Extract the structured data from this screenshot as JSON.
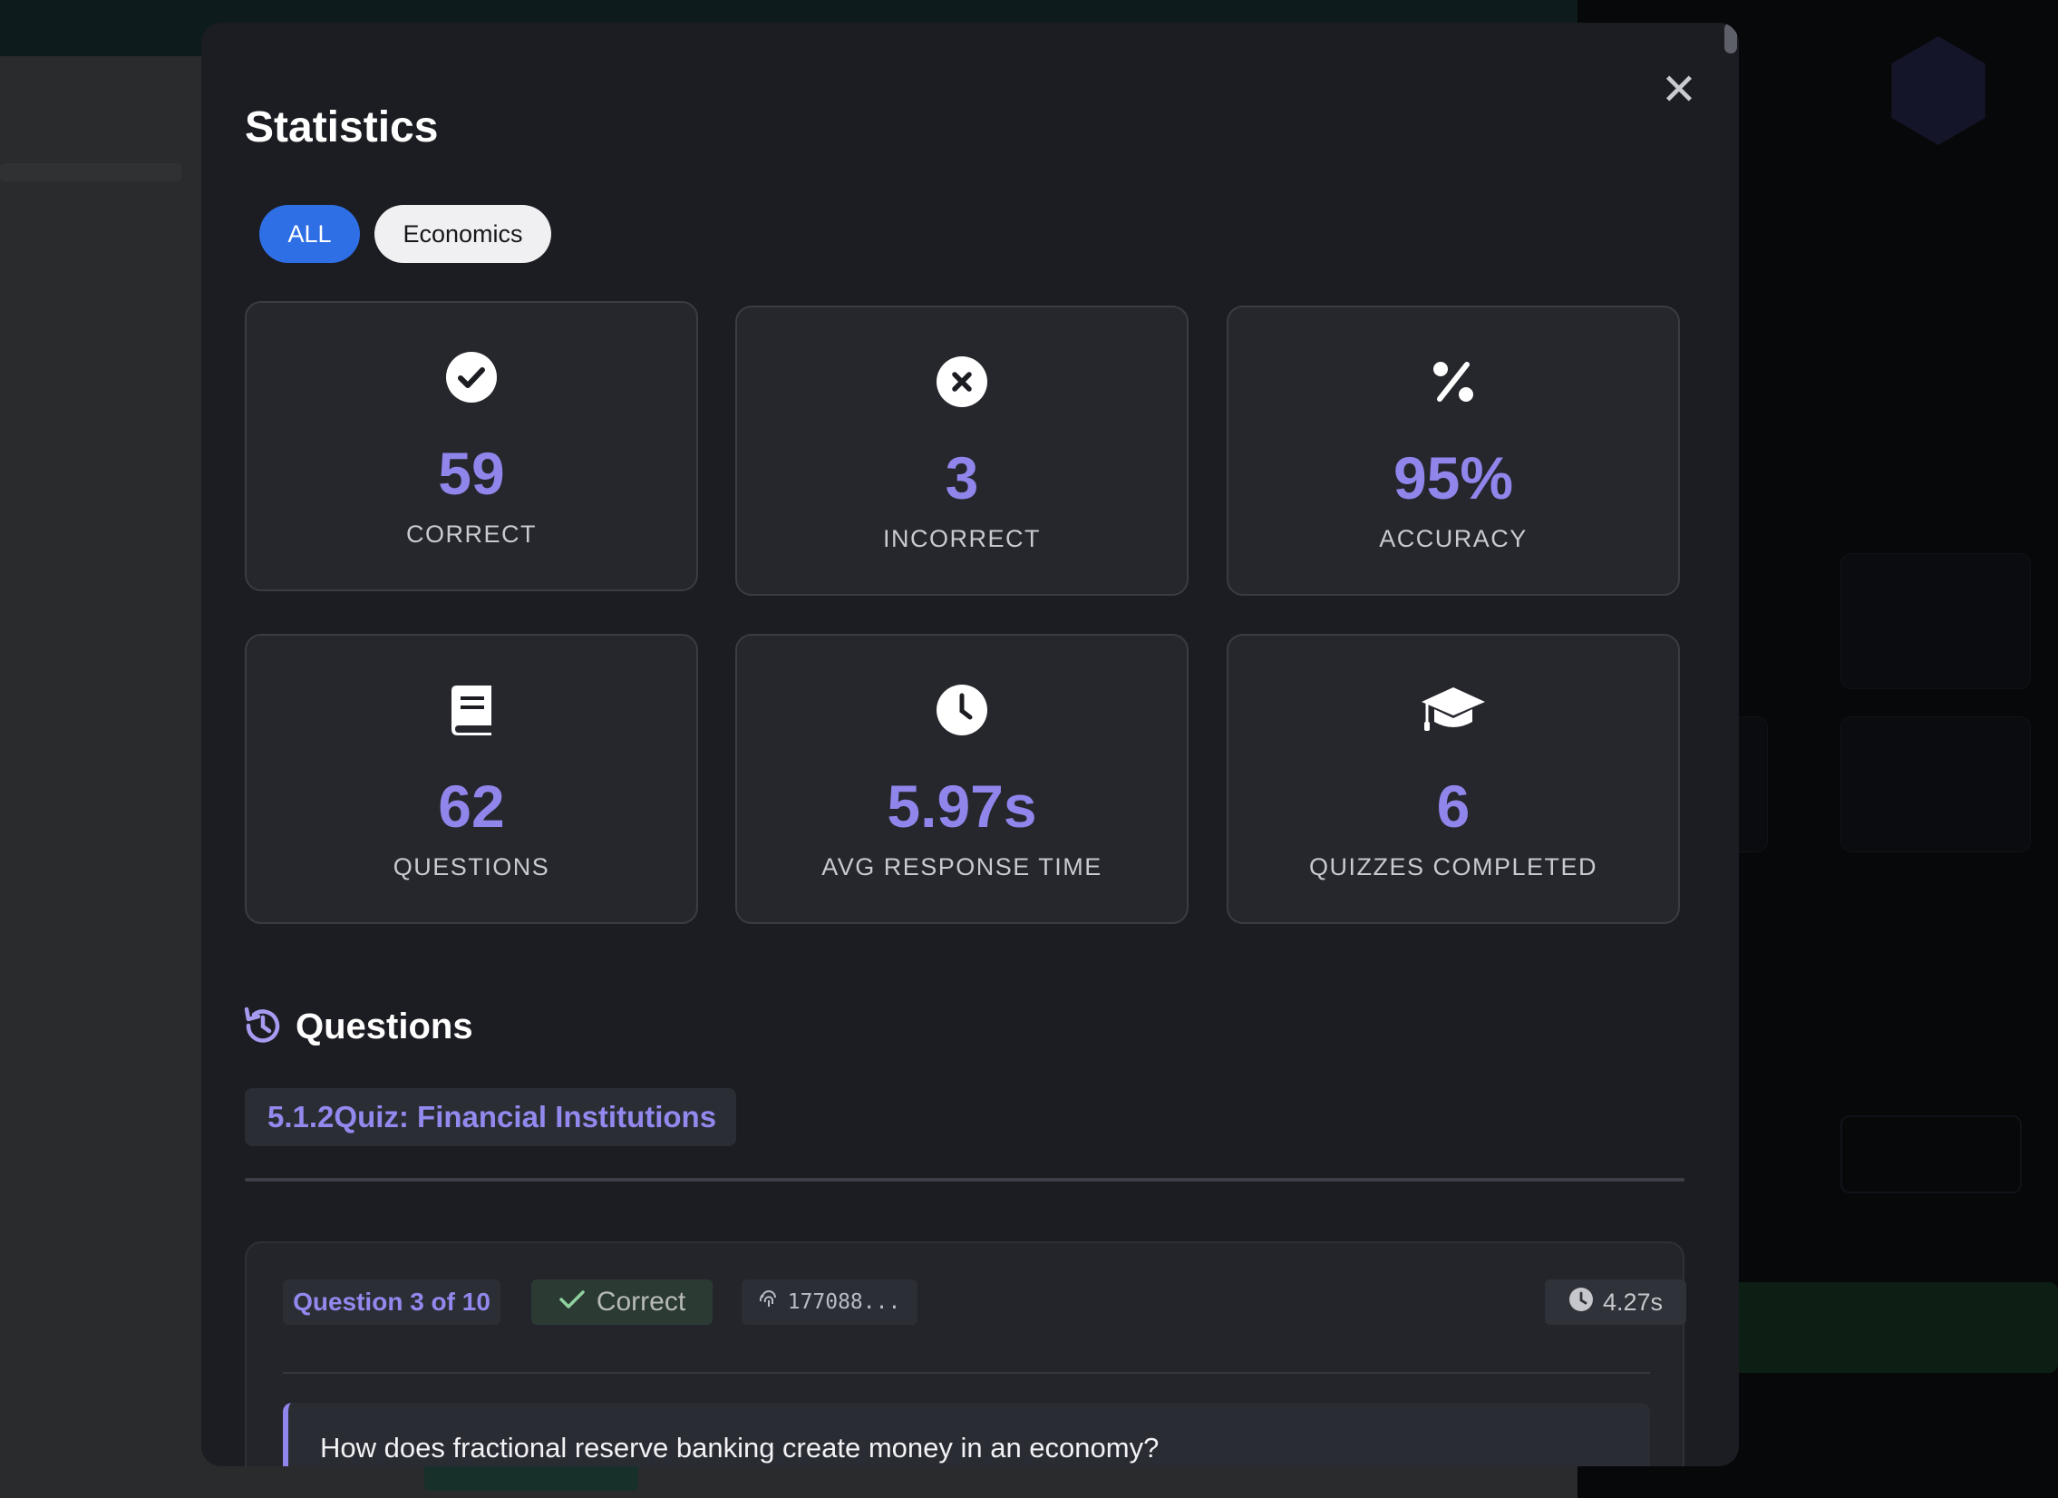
{
  "modal": {
    "title": "Statistics",
    "close_label": "✕"
  },
  "filters": {
    "tabs": [
      {
        "label": "ALL",
        "active": true
      },
      {
        "label": "Economics",
        "active": false
      }
    ]
  },
  "stats": [
    {
      "icon": "check-circle-icon",
      "value": "59",
      "label": "CORRECT"
    },
    {
      "icon": "x-circle-icon",
      "value": "3",
      "label": "INCORRECT"
    },
    {
      "icon": "percent-icon",
      "value": "95%",
      "label": "ACCURACY"
    },
    {
      "icon": "book-icon",
      "value": "62",
      "label": "QUESTIONS"
    },
    {
      "icon": "clock-icon",
      "value": "5.97s",
      "label": "AVG RESPONSE TIME"
    },
    {
      "icon": "graduation-cap-icon",
      "value": "6",
      "label": "QUIZZES COMPLETED"
    }
  ],
  "questions_section": {
    "title": "Questions",
    "icon": "history-icon",
    "quiz_title": "5.1.2Quiz: Financial Institutions",
    "question": {
      "number_label": "Question 3 of 10",
      "status": "Correct",
      "fingerprint": "177088...",
      "time": "4.27s",
      "text": "How does fractional reserve banking create money in an economy?"
    }
  },
  "colors": {
    "accent": "#8f85ea",
    "tab_active": "#2f6fe6",
    "modal_bg": "#1c1d22"
  }
}
